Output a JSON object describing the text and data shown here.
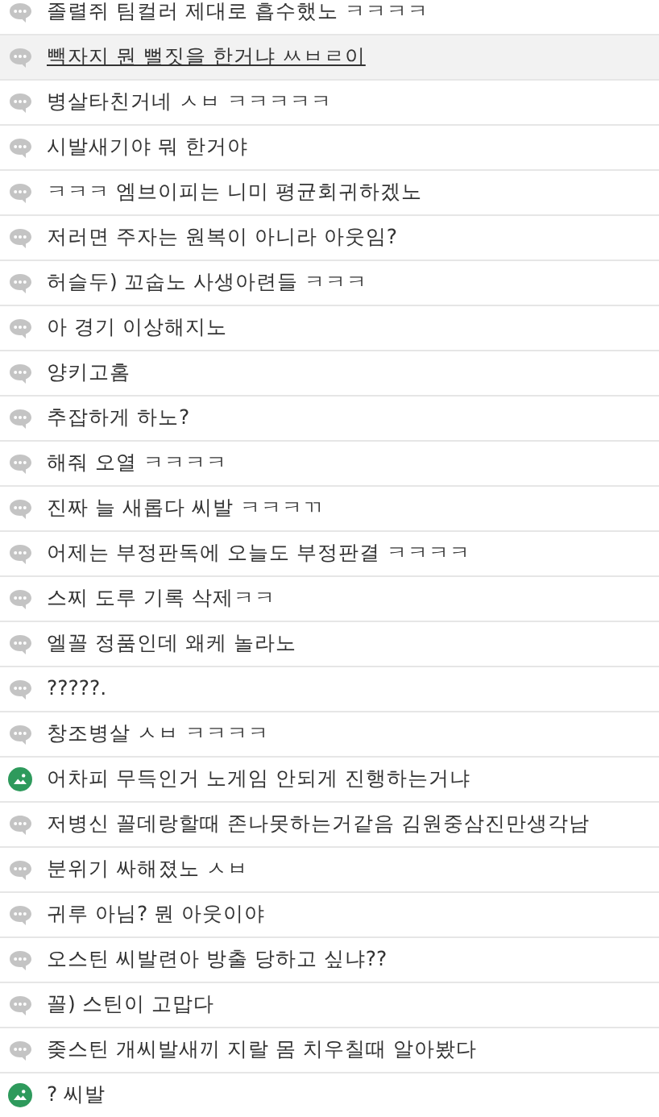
{
  "posts": [
    {
      "kind": "comment",
      "text": "졸렬쥐 팀컬러 제대로 흡수했노 ㅋㅋㅋㅋ",
      "selected": false
    },
    {
      "kind": "comment",
      "text": "빽자지 뭔 뻘짓을 한거냐 ㅆㅂㄹ이",
      "selected": true
    },
    {
      "kind": "comment",
      "text": "병살타친거네 ㅅㅂ ㅋㅋㅋㅋㅋ",
      "selected": false
    },
    {
      "kind": "comment",
      "text": "시발새기야 뭐 한거야",
      "selected": false
    },
    {
      "kind": "comment",
      "text": "ㅋㅋㅋ 엠브이피는 니미 평균회귀하겠노",
      "selected": false
    },
    {
      "kind": "comment",
      "text": "저러면 주자는 원복이 아니라 아웃임?",
      "selected": false
    },
    {
      "kind": "comment",
      "text": "허슬두) 꼬숩노 사생아련들 ㅋㅋㅋ",
      "selected": false
    },
    {
      "kind": "comment",
      "text": "아 경기 이상해지노",
      "selected": false
    },
    {
      "kind": "comment",
      "text": "양키고홈",
      "selected": false
    },
    {
      "kind": "comment",
      "text": "추잡하게 하노?",
      "selected": false
    },
    {
      "kind": "comment",
      "text": "해줘 오열 ㅋㅋㅋㅋ",
      "selected": false
    },
    {
      "kind": "comment",
      "text": "진짜 늘 새롭다 씨발 ㅋㅋㅋㄲ",
      "selected": false
    },
    {
      "kind": "comment",
      "text": "어제는 부정판독에 오늘도 부정판결 ㅋㅋㅋㅋ",
      "selected": false
    },
    {
      "kind": "comment",
      "text": "스찌 도루 기록 삭제ㅋㅋ",
      "selected": false
    },
    {
      "kind": "comment",
      "text": "엘꼴 정품인데 왜케 놀라노",
      "selected": false
    },
    {
      "kind": "comment",
      "text": "?????.",
      "selected": false
    },
    {
      "kind": "comment",
      "text": "창조병살 ㅅㅂ ㅋㅋㅋㅋ",
      "selected": false
    },
    {
      "kind": "image",
      "text": "어차피 무득인거 노게임 안되게 진행하는거냐",
      "selected": false
    },
    {
      "kind": "comment",
      "text": "저병신 꼴데랑할때 존나못하는거같음 김원중삼진만생각남",
      "selected": false
    },
    {
      "kind": "comment",
      "text": "분위기 싸해졌노 ㅅㅂ",
      "selected": false
    },
    {
      "kind": "comment",
      "text": "귀루 아님? 뭔 아웃이야",
      "selected": false
    },
    {
      "kind": "comment",
      "text": "오스틴 씨발련아 방출 당하고 싶냐??",
      "selected": false
    },
    {
      "kind": "comment",
      "text": "꼴) 스틴이 고맙다",
      "selected": false
    },
    {
      "kind": "comment",
      "text": "좆스틴 개씨발새끼 지랄 몸 치우칠때 알아봤다",
      "selected": false
    },
    {
      "kind": "image",
      "text": "? 씨발",
      "selected": false
    }
  ]
}
